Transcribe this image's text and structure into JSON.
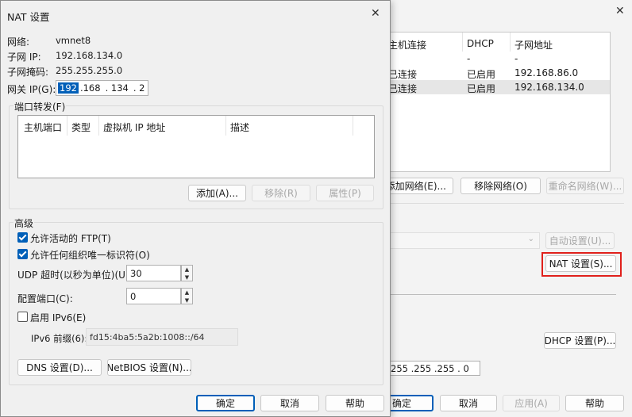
{
  "bg_window": {
    "columns": [
      "主机连接",
      "DHCP",
      "子网地址"
    ],
    "rows": [
      [
        "",
        "-",
        "-"
      ],
      [
        "已连接",
        "已启用",
        "192.168.86.0"
      ],
      [
        "已连接",
        "已启用",
        "192.168.134.0"
      ]
    ],
    "add_network_label": "添加网络(E)...",
    "remove_network_label": "移除网络(O)",
    "rename_network_label": "重命名网络(W)...",
    "auto_settings_label": "自动设置(U)...",
    "nat_settings_label": "NAT 设置(S)...",
    "dhcp_settings_label": "DHCP 设置(P)...",
    "subnet_mask_value": "255 .255 .255 . 0",
    "ok_label": "确定",
    "cancel_label": "取消",
    "apply_label": "应用(A)",
    "help_label": "帮助",
    "close_glyph": "✕"
  },
  "nat_dialog": {
    "title": "NAT 设置",
    "close_glyph": "✕",
    "network_label": "网络:",
    "network_value": "vmnet8",
    "subnet_ip_label": "子网 IP:",
    "subnet_ip_value": "192.168.134.0",
    "subnet_mask_label": "子网掩码:",
    "subnet_mask_value": "255.255.255.0",
    "gateway_label": "网关 IP(G):",
    "gateway_parts": [
      "192",
      ".168",
      ". 134",
      ". 2"
    ],
    "port_forward_title": "端口转发(F)",
    "port_columns": [
      "主机端口",
      "类型",
      "虚拟机 IP 地址",
      "描述"
    ],
    "add_label": "添加(A)...",
    "remove_label": "移除(R)",
    "properties_label": "属性(P)",
    "advanced_title": "高级",
    "allow_ftp_label": "允许活动的 FTP(T)",
    "allow_ftp_checked": true,
    "allow_oui_label": "允许任何组织唯一标识符(O)",
    "allow_oui_checked": true,
    "udp_timeout_label": "UDP 超时(以秒为单位)(U):",
    "udp_timeout_value": "30",
    "config_port_label": "配置端口(C):",
    "config_port_value": "0",
    "enable_ipv6_label": "启用 IPv6(E)",
    "enable_ipv6_checked": false,
    "ipv6_prefix_label": "IPv6 前缀(6):",
    "ipv6_prefix_value": "fd15:4ba5:5a2b:1008::/64",
    "dns_label": "DNS 设置(D)...",
    "netbios_label": "NetBIOS 设置(N)...",
    "ok_label": "确定",
    "cancel_label": "取消",
    "help_label": "帮助"
  },
  "colors": {
    "accent": "#005fb8",
    "highlight_border": "#e0201b",
    "selected_row": "#e6e6e6"
  }
}
